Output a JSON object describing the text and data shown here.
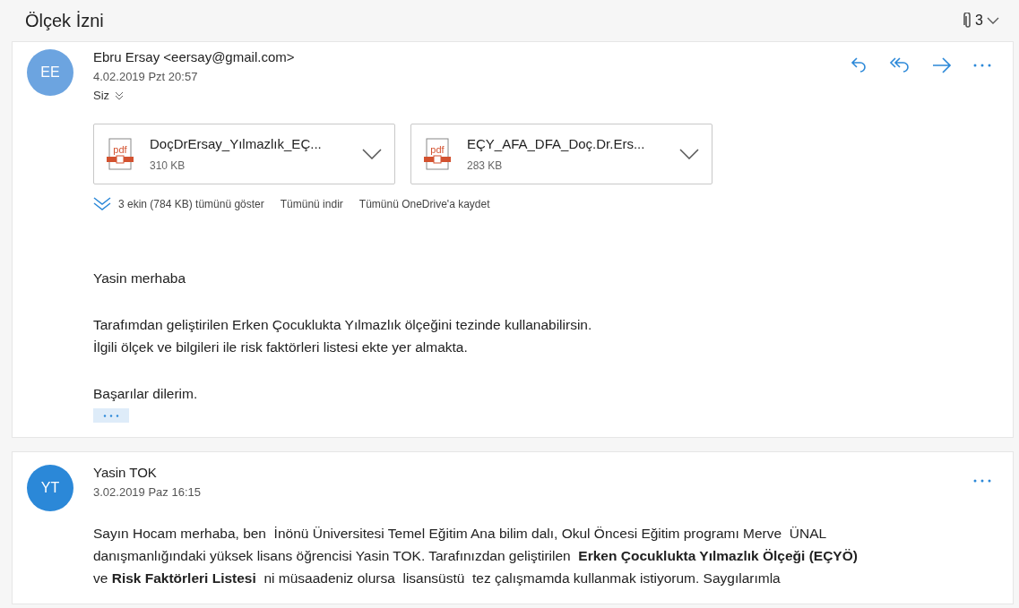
{
  "header": {
    "title": "Ölçek İzni",
    "attachment_count": "3"
  },
  "messages": [
    {
      "initials": "EE",
      "color": "#6ca4e0",
      "sender": "Ebru Ersay <eersay@gmail.com>",
      "date": "4.02.2019 Pzt 20:57",
      "recipients": "Siz",
      "actions": [
        {
          "kind": "reply"
        },
        {
          "kind": "reply_all"
        },
        {
          "kind": "forward"
        },
        {
          "kind": "more"
        }
      ],
      "attachments": [
        {
          "type_label": "pdf",
          "name": "DoçDrErsay_Yılmazlık_EÇ...",
          "size": "310 KB"
        },
        {
          "type_label": "pdf",
          "name": "EÇY_AFA_DFA_Doç.Dr.Ers...",
          "size": "283 KB"
        }
      ],
      "attachment_links": [
        "3 ekin (784 KB) tümünü göster",
        "Tümünü indir",
        "Tümünü OneDrive'a kaydet"
      ],
      "paragraphs": [
        [
          "Yasin merhaba"
        ],
        [
          "Tarafımdan geliştirilen Erken Çocuklukta Yılmazlık ölçeğini tezinde kullanabilirsin.",
          "İlgili ölçek ve bilgileri ile risk faktörleri listesi ekte yer almakta."
        ],
        [
          "Başarılar dilerim."
        ]
      ],
      "quoted_text_hidden": true
    },
    {
      "initials": "YT",
      "color": "#2b88d8",
      "sender": "Yasin TOK",
      "date": "3.02.2019 Paz 16:15",
      "actions": [
        {
          "kind": "more"
        }
      ],
      "paragraphs": [
        [
          "Sayın Hocam merhaba, ben  İnönü Üniversitesi Temel Eğitim Ana bilim dalı, Okul Öncesi Eğitim programı Merve  ÜNAL",
          "danışmanlığındaki yüksek lisans öğrencisi Yasin TOK. Tarafınızdan geliştirilen  **Erken Çocuklukta Yılmazlık Ölçeği (EÇYÖ)**",
          "ve **Risk Faktörleri Listesi**  ni müsaadeniz olursa  lisansüstü  tez çalışmamda kullanmak istiyorum. Saygılarımla"
        ]
      ]
    }
  ]
}
